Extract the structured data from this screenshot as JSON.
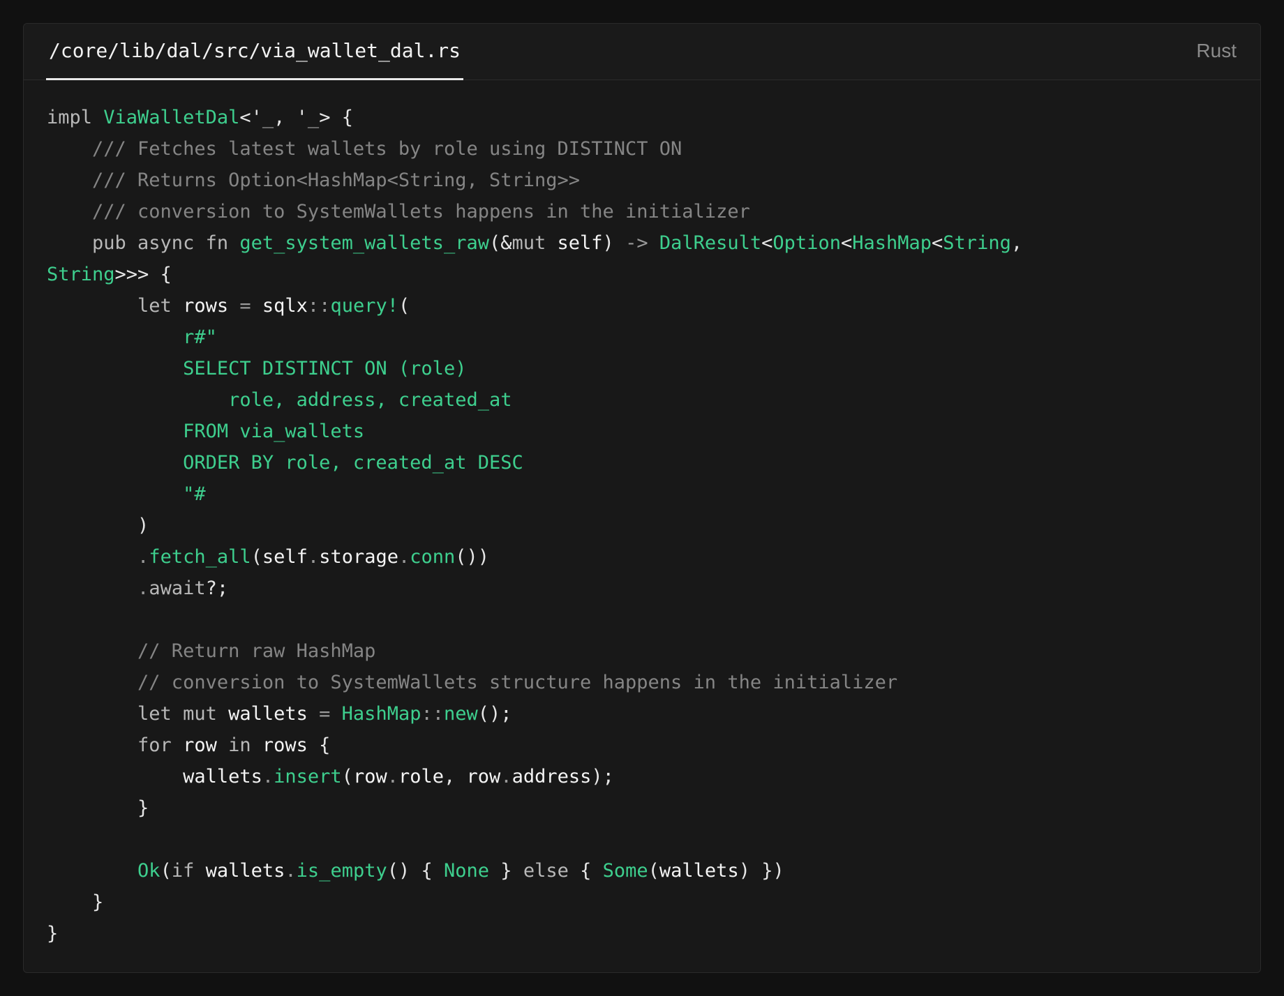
{
  "header": {
    "file_path": "/core/lib/dal/src/via_wallet_dal.rs",
    "language": "Rust"
  },
  "code": {
    "lines": [
      [
        [
          "kw",
          "impl "
        ],
        [
          "ty",
          "ViaWalletDal"
        ],
        [
          "pu",
          "<'"
        ],
        [
          "kw",
          "_"
        ],
        [
          "pu",
          ", '"
        ],
        [
          "kw",
          "_"
        ],
        [
          "pu",
          "> {"
        ]
      ],
      [
        [
          "cm",
          "    /// Fetches latest wallets by role using DISTINCT ON"
        ]
      ],
      [
        [
          "cm",
          "    /// Returns Option<HashMap<String, String>>"
        ]
      ],
      [
        [
          "cm",
          "    /// conversion to SystemWallets happens in the initializer"
        ]
      ],
      [
        [
          "kw",
          "    pub async fn "
        ],
        [
          "fn",
          "get_system_wallets_raw"
        ],
        [
          "pu",
          "(&"
        ],
        [
          "kw",
          "mut "
        ],
        [
          "id",
          "self"
        ],
        [
          "pu",
          ") "
        ],
        [
          "op",
          "->"
        ],
        [
          "pu",
          " "
        ],
        [
          "ty",
          "DalResult"
        ],
        [
          "pu",
          "<"
        ],
        [
          "ty",
          "Option"
        ],
        [
          "pu",
          "<"
        ],
        [
          "ty",
          "HashMap"
        ],
        [
          "pu",
          "<"
        ],
        [
          "ty",
          "String"
        ],
        [
          "pu",
          ","
        ]
      ],
      [
        [
          "ty",
          "String"
        ],
        [
          "pu",
          ">>> {"
        ]
      ],
      [
        [
          "kw",
          "        let "
        ],
        [
          "id",
          "rows "
        ],
        [
          "op",
          "="
        ],
        [
          "pu",
          " "
        ],
        [
          "id",
          "sqlx"
        ],
        [
          "op",
          "::"
        ],
        [
          "fn",
          "query!"
        ],
        [
          "pu",
          "("
        ]
      ],
      [
        [
          "str",
          "            r#\""
        ]
      ],
      [
        [
          "str",
          "            SELECT DISTINCT ON (role)"
        ]
      ],
      [
        [
          "str",
          "                role, address, created_at"
        ]
      ],
      [
        [
          "str",
          "            FROM via_wallets"
        ]
      ],
      [
        [
          "str",
          "            ORDER BY role, created_at DESC"
        ]
      ],
      [
        [
          "str",
          "            \"#"
        ]
      ],
      [
        [
          "pu",
          "        )"
        ]
      ],
      [
        [
          "op",
          "        ."
        ],
        [
          "fn",
          "fetch_all"
        ],
        [
          "pu",
          "("
        ],
        [
          "id",
          "self"
        ],
        [
          "op",
          "."
        ],
        [
          "id",
          "storage"
        ],
        [
          "op",
          "."
        ],
        [
          "fn",
          "conn"
        ],
        [
          "pu",
          "())"
        ]
      ],
      [
        [
          "op",
          "        ."
        ],
        [
          "kw",
          "await"
        ],
        [
          "pu",
          "?;"
        ]
      ],
      [],
      [
        [
          "cm",
          "        // Return raw HashMap"
        ]
      ],
      [
        [
          "cm",
          "        // conversion to SystemWallets structure happens in the initializer"
        ]
      ],
      [
        [
          "kw",
          "        let mut "
        ],
        [
          "id",
          "wallets "
        ],
        [
          "op",
          "="
        ],
        [
          "pu",
          " "
        ],
        [
          "ty",
          "HashMap"
        ],
        [
          "op",
          "::"
        ],
        [
          "fn",
          "new"
        ],
        [
          "pu",
          "();"
        ]
      ],
      [
        [
          "kw",
          "        for "
        ],
        [
          "id",
          "row "
        ],
        [
          "kw",
          "in "
        ],
        [
          "id",
          "rows "
        ],
        [
          "pu",
          "{"
        ]
      ],
      [
        [
          "id",
          "            wallets"
        ],
        [
          "op",
          "."
        ],
        [
          "fn",
          "insert"
        ],
        [
          "pu",
          "("
        ],
        [
          "id",
          "row"
        ],
        [
          "op",
          "."
        ],
        [
          "id",
          "role"
        ],
        [
          "pu",
          ", "
        ],
        [
          "id",
          "row"
        ],
        [
          "op",
          "."
        ],
        [
          "id",
          "address"
        ],
        [
          "pu",
          ");"
        ]
      ],
      [
        [
          "pu",
          "        }"
        ]
      ],
      [],
      [
        [
          "ty",
          "        Ok"
        ],
        [
          "pu",
          "("
        ],
        [
          "kw",
          "if "
        ],
        [
          "id",
          "wallets"
        ],
        [
          "op",
          "."
        ],
        [
          "fn",
          "is_empty"
        ],
        [
          "pu",
          "() { "
        ],
        [
          "ty",
          "None"
        ],
        [
          "pu",
          " } "
        ],
        [
          "kw",
          "else "
        ],
        [
          "pu",
          "{ "
        ],
        [
          "ty",
          "Some"
        ],
        [
          "pu",
          "("
        ],
        [
          "id",
          "wallets"
        ],
        [
          "pu",
          ") })"
        ]
      ],
      [
        [
          "pu",
          "    }"
        ]
      ],
      [
        [
          "pu",
          "}"
        ]
      ]
    ]
  }
}
